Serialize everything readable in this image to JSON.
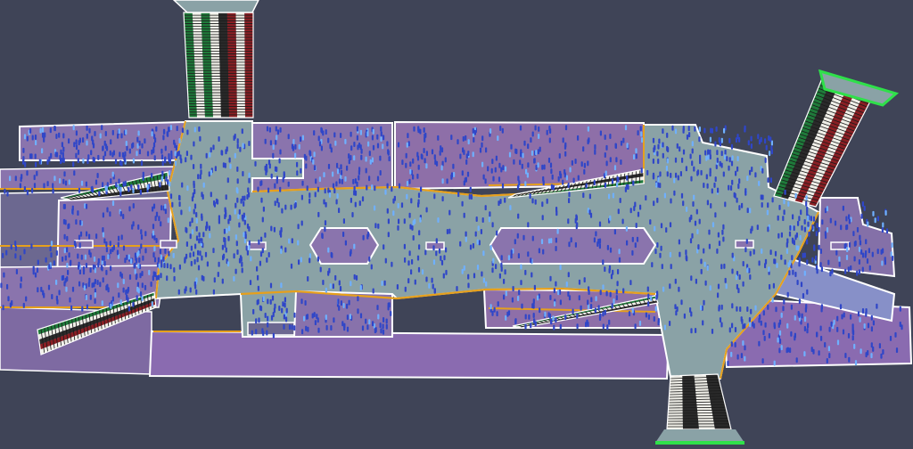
{
  "scene": {
    "colors": {
      "background": "#3f4457",
      "concourse": "#8aa2a6",
      "platform_zone": "#8a72a8",
      "platform_zone_alt": "#7f6aa0",
      "lower_deck": "#8c6ab0",
      "outline": "#ffffff",
      "boundary_line": "#e6a01c",
      "agent": "#2f46c8",
      "agent_highlight": "#6fb0ff",
      "stair_green": "#1f7a3a",
      "stair_red": "#8a1f24",
      "stair_white": "#f0efe8",
      "exit_bar": "#2fe04a"
    },
    "elements": [
      "concourse-floor",
      "platform-area",
      "escalator-stairs",
      "exit-zone",
      "pedestrian-agents"
    ]
  }
}
